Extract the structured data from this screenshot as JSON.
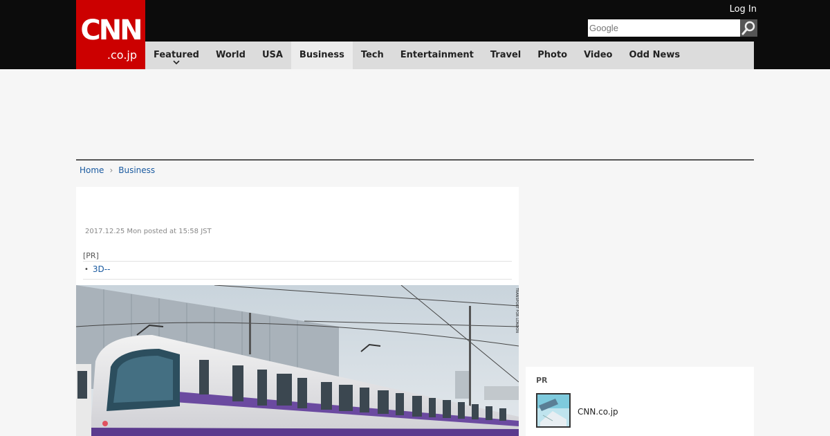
{
  "header": {
    "logo_main": "CNN",
    "logo_sub": ".co.jp",
    "login_label": "Log In",
    "search_placeholder": "Google"
  },
  "nav": {
    "items": [
      {
        "label": "Featured"
      },
      {
        "label": "World"
      },
      {
        "label": "USA"
      },
      {
        "label": "Business"
      },
      {
        "label": "Tech"
      },
      {
        "label": "Entertainment"
      },
      {
        "label": "Travel"
      },
      {
        "label": "Photo"
      },
      {
        "label": "Video"
      },
      {
        "label": "Odd News"
      }
    ],
    "active": "Business"
  },
  "breadcrumb": {
    "home": "Home",
    "separator": "›",
    "current": "Business"
  },
  "article": {
    "posted": "2017.12.25 Mon posted at 15:58 JST",
    "pr_label": "[PR]",
    "pr_link": "3D--",
    "image_credit": "TRANSPORT FOR LONDON"
  },
  "sidebar": {
    "pr_label": "PR",
    "item_label": "CNN.co.jp"
  },
  "colors": {
    "brand_red": "#cc0000",
    "header_bg": "#0c0c0c",
    "nav_bg": "#dcdcdc",
    "link": "#1a5aa0"
  },
  "icons": {
    "search": "magnifier-icon",
    "featured_dropdown": "chevron-down-icon",
    "breadcrumb_separator": "chevron-right-icon"
  }
}
